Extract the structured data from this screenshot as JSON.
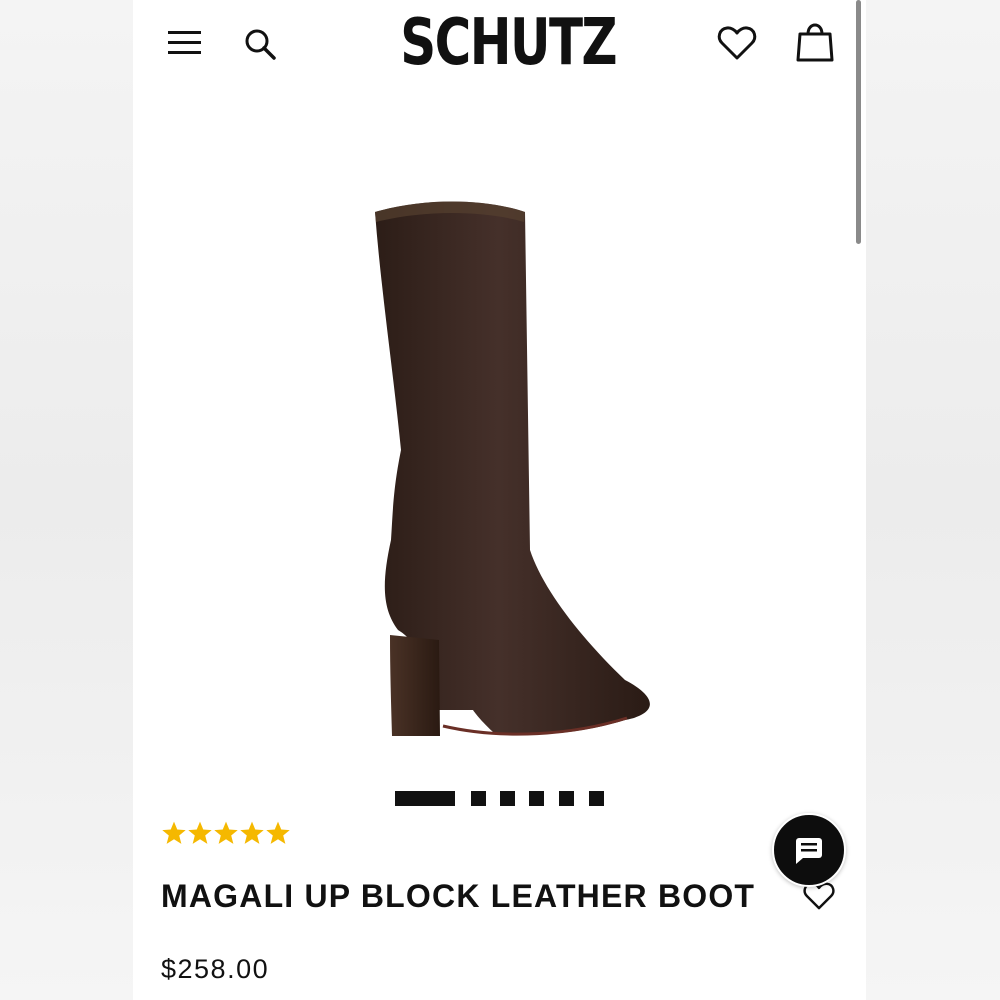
{
  "header": {
    "brand": "SCHUTZ",
    "menu_icon": "hamburger-menu-icon",
    "search_icon": "search-icon",
    "wishlist_icon": "heart-icon",
    "cart_icon": "shopping-bag-icon"
  },
  "product": {
    "image_alt": "brown knee-high boot",
    "rating_value": 5,
    "rating_max": 5,
    "star_color": "#f5b800",
    "title": "MAGALI UP BLOCK LEATHER BOOT",
    "price": "$258.00",
    "wishlist_icon": "heart-icon"
  },
  "gallery": {
    "total_images": 7,
    "active_index": 0
  },
  "chat": {
    "icon": "chat-bubble-icon"
  },
  "colors": {
    "text": "#111111",
    "boot": "#3d2a22"
  }
}
